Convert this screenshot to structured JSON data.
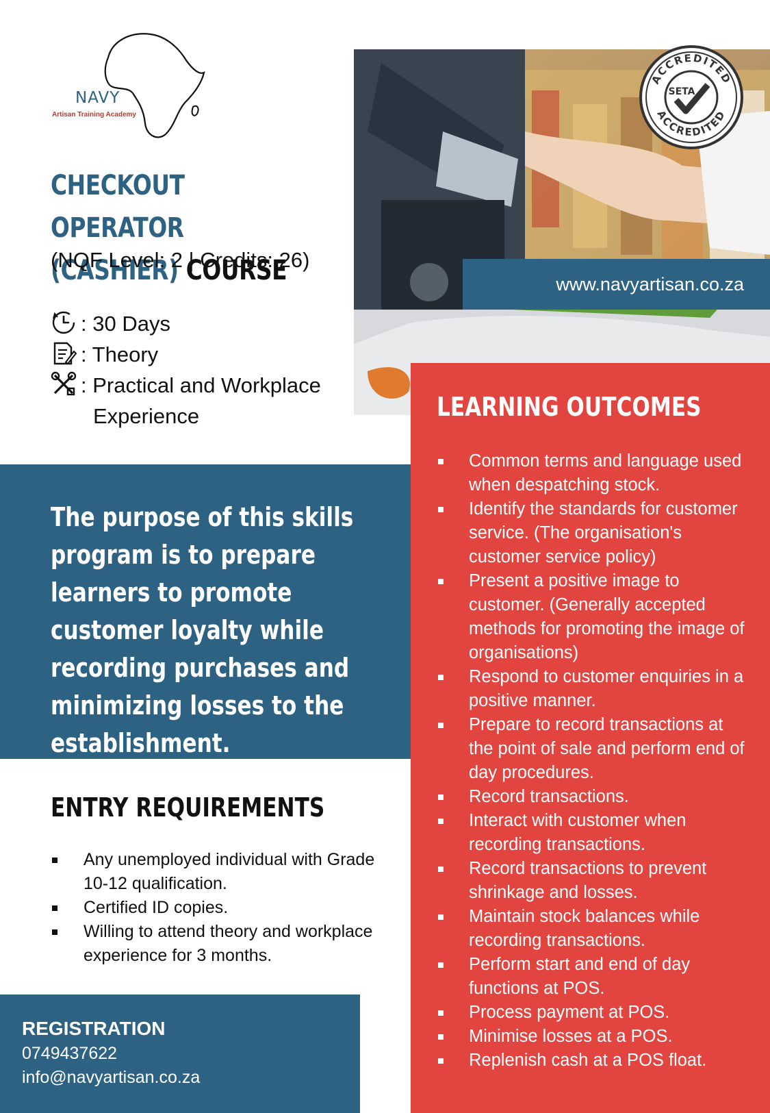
{
  "logo": {
    "name": "NAVY",
    "subtitle": "Artisan Training Academy"
  },
  "course": {
    "title_line1": "CHECKOUT OPERATOR",
    "title_line2_blue": "(CASHIER)",
    "title_line2_black": "COURSE",
    "nqf": "(NQF Level: 2 | Credits: 26)"
  },
  "info": {
    "duration": ": 30 Days",
    "theory": ": Theory",
    "practical_line1": ": Practical and Workplace",
    "practical_line2": "Experience"
  },
  "website": "www.navyartisan.co.za",
  "seal": {
    "top": "ACCREDITED",
    "center": "SETA",
    "bottom": "ACCREDITED"
  },
  "learning_outcomes": {
    "title": "LEARNING OUTCOMES",
    "items": [
      "Common terms and language used when despatching stock.",
      "Identify the standards for customer service. (The organisation's customer service policy)",
      "Present a positive image to customer. (Generally accepted methods for promoting the image of organisations)",
      "Respond to customer enquiries in a positive manner.",
      "Prepare to record transactions at the point of sale and perform end of day procedures.",
      "Record transactions.",
      "Interact with customer when recording transactions.",
      "Record transactions to prevent shrinkage and losses.",
      "Maintain stock balances while recording transactions.",
      "Perform start and end of day functions at POS.",
      "Process payment at POS.",
      "Minimise losses at a POS.",
      "Replenish cash at a POS float."
    ]
  },
  "purpose": "The purpose of this skills program is to prepare learners to promote customer loyalty while recording purchases and minimizing losses to the establishment.",
  "entry_requirements": {
    "title": "ENTRY REQUIREMENTS",
    "items": [
      "Any unemployed individual with Grade 10-12 qualification.",
      "Certified ID copies.",
      "Willing to attend theory and workplace experience for 3 months."
    ]
  },
  "registration": {
    "title": "REGISTRATION",
    "phone": "0749437622",
    "email": "info@navyartisan.co.za"
  },
  "colors": {
    "navy_blue": "#2e6283",
    "red": "#e2443f",
    "white": "#ffffff"
  }
}
